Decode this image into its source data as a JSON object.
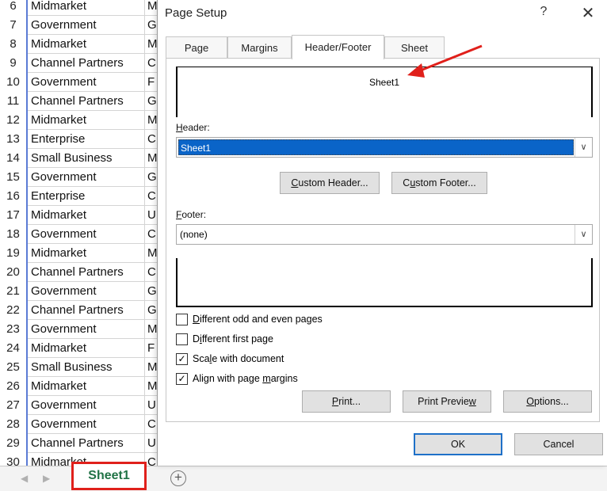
{
  "spreadsheet": {
    "rows": [
      {
        "num": "6",
        "segment": "Midmarket",
        "col_b": "M"
      },
      {
        "num": "7",
        "segment": "Government",
        "col_b": "G"
      },
      {
        "num": "8",
        "segment": "Midmarket",
        "col_b": "M"
      },
      {
        "num": "9",
        "segment": "Channel Partners",
        "col_b": "C"
      },
      {
        "num": "10",
        "segment": "Government",
        "col_b": "F"
      },
      {
        "num": "11",
        "segment": "Channel Partners",
        "col_b": "G"
      },
      {
        "num": "12",
        "segment": "Midmarket",
        "col_b": "M"
      },
      {
        "num": "13",
        "segment": "Enterprise",
        "col_b": "C"
      },
      {
        "num": "14",
        "segment": "Small Business",
        "col_b": "M"
      },
      {
        "num": "15",
        "segment": "Government",
        "col_b": "G"
      },
      {
        "num": "16",
        "segment": "Enterprise",
        "col_b": "C"
      },
      {
        "num": "17",
        "segment": "Midmarket",
        "col_b": "U"
      },
      {
        "num": "18",
        "segment": "Government",
        "col_b": "C"
      },
      {
        "num": "19",
        "segment": "Midmarket",
        "col_b": "M"
      },
      {
        "num": "20",
        "segment": "Channel Partners",
        "col_b": "C"
      },
      {
        "num": "21",
        "segment": "Government",
        "col_b": "G"
      },
      {
        "num": "22",
        "segment": "Channel Partners",
        "col_b": "G"
      },
      {
        "num": "23",
        "segment": "Government",
        "col_b": "M"
      },
      {
        "num": "24",
        "segment": "Midmarket",
        "col_b": "F"
      },
      {
        "num": "25",
        "segment": "Small Business",
        "col_b": "M"
      },
      {
        "num": "26",
        "segment": "Midmarket",
        "col_b": "M"
      },
      {
        "num": "27",
        "segment": "Government",
        "col_b": "U"
      },
      {
        "num": "28",
        "segment": "Government",
        "col_b": "C"
      },
      {
        "num": "29",
        "segment": "Channel Partners",
        "col_b": "U"
      },
      {
        "num": "30",
        "segment": "Midmarket",
        "col_b": "C"
      }
    ],
    "sheet_tab": "Sheet1",
    "add_sheet_symbol": "+",
    "nav_prev_symbol": "◀",
    "nav_next_symbol": "▶"
  },
  "dialog": {
    "title": "Page Setup",
    "help_symbol": "?",
    "close_symbol": "✕",
    "tabs": [
      "Page",
      "Margins",
      "Header/Footer",
      "Sheet"
    ],
    "active_tab": "Header/Footer",
    "header_preview_text": "Sheet1",
    "header_label": {
      "pre": "",
      "key": "H",
      "post": "eader:"
    },
    "header_value": "Sheet1",
    "custom_header_button": {
      "pre": "",
      "key": "C",
      "post": "ustom Header..."
    },
    "custom_footer_button": {
      "pre": "C",
      "key": "u",
      "post": "stom Footer..."
    },
    "footer_label": {
      "pre": "",
      "key": "F",
      "post": "ooter:"
    },
    "footer_value": "(none)",
    "dropdown_symbol": "∨",
    "checkboxes": [
      {
        "pre": "",
        "key": "D",
        "post": "ifferent odd and even pages",
        "checked": false
      },
      {
        "pre": "D",
        "key": "i",
        "post": "fferent first page",
        "checked": false
      },
      {
        "pre": "Sca",
        "key": "l",
        "post": "e with document",
        "checked": true
      },
      {
        "pre": "Align with page ",
        "key": "m",
        "post": "argins",
        "checked": true
      }
    ],
    "check_mark": "✓",
    "print_button": {
      "pre": "",
      "key": "P",
      "post": "rint..."
    },
    "print_preview_button": {
      "pre": "Print Previe",
      "key": "w",
      "post": ""
    },
    "options_button": {
      "pre": "",
      "key": "O",
      "post": "ptions..."
    },
    "ok_button": "OK",
    "cancel_button": "Cancel"
  },
  "annotation": {
    "arrow_color": "#e0201b",
    "highlight_color": "#e0201b"
  }
}
